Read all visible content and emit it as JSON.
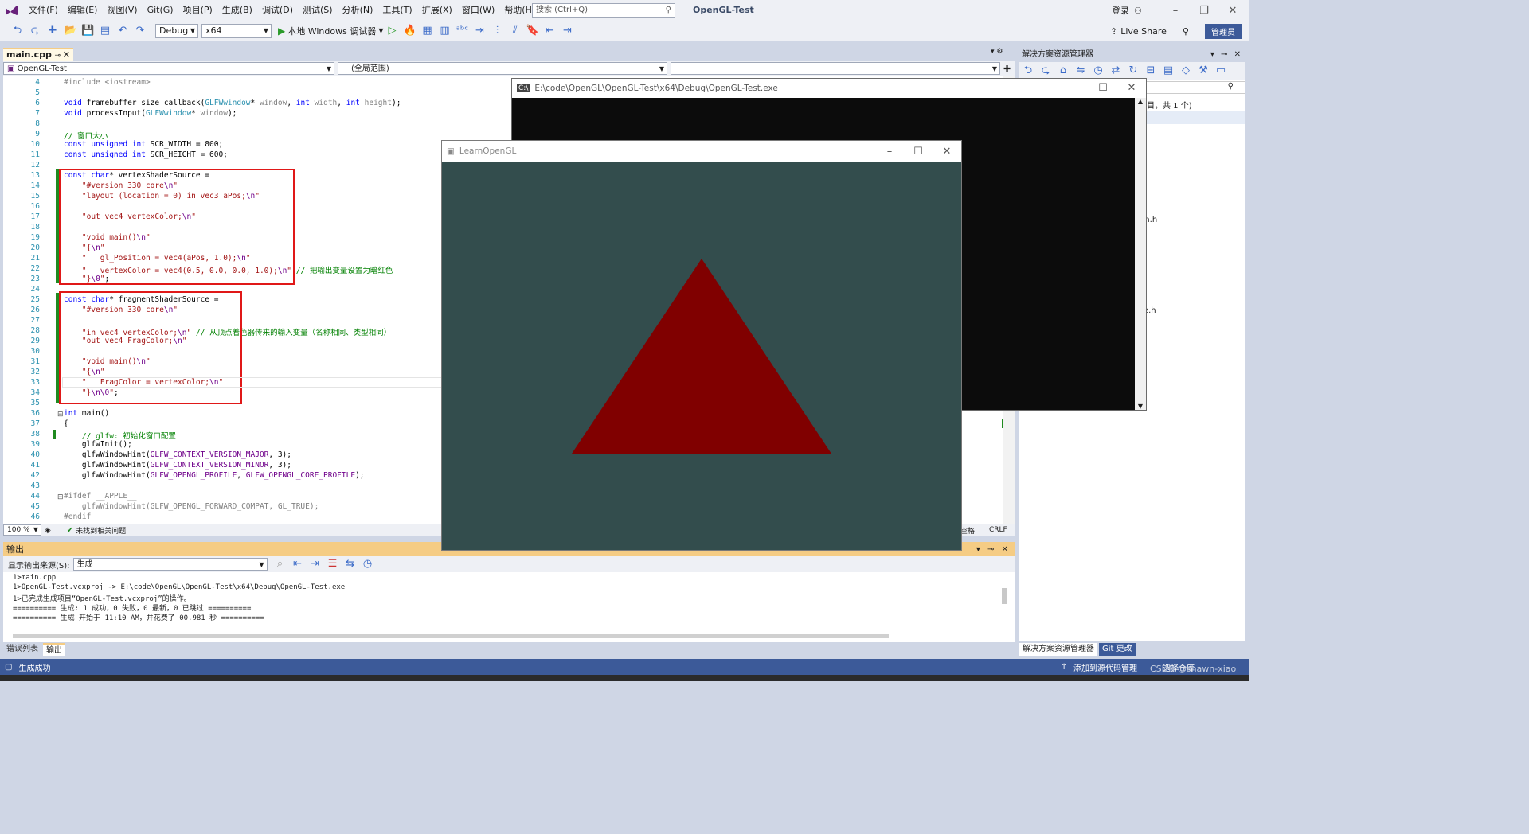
{
  "menubar": {
    "items": [
      "文件(F)",
      "编辑(E)",
      "视图(V)",
      "Git(G)",
      "项目(P)",
      "生成(B)",
      "调试(D)",
      "测试(S)",
      "分析(N)",
      "工具(T)",
      "扩展(X)",
      "窗口(W)",
      "帮助(H)"
    ],
    "search_placeholder": "搜索 (Ctrl+Q)",
    "app_title": "OpenGL-Test",
    "login_label": "登录"
  },
  "toolbar": {
    "config": "Debug",
    "platform": "x64",
    "run_label": "本地 Windows 调试器",
    "live_share_label": "Live Share",
    "admin_label": "管理员"
  },
  "editor": {
    "file_tab": "main.cpp",
    "nav_project": "OpenGL-Test",
    "nav_scope": "(全局范围)",
    "zoom": "100 %",
    "issues": "未找到相关问题",
    "spaces": "空格",
    "line_ending": "CRLF"
  },
  "code_lines": [
    {
      "n": "4",
      "html": "<span class=\"gray\">#include &lt;iostream&gt;</span>"
    },
    {
      "n": "5",
      "html": ""
    },
    {
      "n": "6",
      "html": "<span class=\"kw\">void</span> framebuffer_size_callback(<span class=\"ty\">GLFWwindow</span>* <span class=\"gray\">window</span>, <span class=\"kw\">int</span> <span class=\"gray\">width</span>, <span class=\"kw\">int</span> <span class=\"gray\">height</span>);"
    },
    {
      "n": "7",
      "html": "<span class=\"kw\">void</span> processInput(<span class=\"ty\">GLFWwindow</span>* <span class=\"gray\">window</span>);"
    },
    {
      "n": "8",
      "html": ""
    },
    {
      "n": "9",
      "html": "<span class=\"cm\">// 窗口大小</span>"
    },
    {
      "n": "10",
      "html": "<span class=\"kw\">const unsigned int</span> SCR_WIDTH = 800;"
    },
    {
      "n": "11",
      "html": "<span class=\"kw\">const unsigned int</span> SCR_HEIGHT = 600;"
    },
    {
      "n": "12",
      "html": ""
    },
    {
      "n": "13",
      "html": "<span class=\"kw\">const char</span>* vertexShaderSource ="
    },
    {
      "n": "14",
      "html": "    <span class=\"str\">\"#version 330 core</span><span class=\"mac\">\\n</span><span class=\"str\">\"</span>"
    },
    {
      "n": "15",
      "html": "    <span class=\"str\">\"layout (location = 0) in vec3 aPos;</span><span class=\"mac\">\\n</span><span class=\"str\">\"</span>"
    },
    {
      "n": "16",
      "html": ""
    },
    {
      "n": "17",
      "html": "    <span class=\"str\">\"out vec4 vertexColor;</span><span class=\"mac\">\\n</span><span class=\"str\">\"</span>"
    },
    {
      "n": "18",
      "html": ""
    },
    {
      "n": "19",
      "html": "    <span class=\"str\">\"void main()</span><span class=\"mac\">\\n</span><span class=\"str\">\"</span>"
    },
    {
      "n": "20",
      "html": "    <span class=\"str\">\"{</span><span class=\"mac\">\\n</span><span class=\"str\">\"</span>"
    },
    {
      "n": "21",
      "html": "    <span class=\"str\">\"   gl_Position = vec4(aPos, 1.0);</span><span class=\"mac\">\\n</span><span class=\"str\">\"</span>"
    },
    {
      "n": "22",
      "html": "    <span class=\"str\">\"   vertexColor = vec4(0.5, 0.0, 0.0, 1.0);</span><span class=\"mac\">\\n</span><span class=\"str\">\"</span> <span class=\"cm\">// 把输出变量设置为暗红色</span>"
    },
    {
      "n": "23",
      "html": "    <span class=\"str\">\"}</span><span class=\"mac\">\\0</span><span class=\"str\">\"</span>;"
    },
    {
      "n": "24",
      "html": ""
    },
    {
      "n": "25",
      "html": "<span class=\"kw\">const char</span>* fragmentShaderSource ="
    },
    {
      "n": "26",
      "html": "    <span class=\"str\">\"#version 330 core</span><span class=\"mac\">\\n</span><span class=\"str\">\"</span>"
    },
    {
      "n": "27",
      "html": ""
    },
    {
      "n": "28",
      "html": "    <span class=\"str\">\"in vec4 vertexColor;</span><span class=\"mac\">\\n</span><span class=\"str\">\"</span> <span class=\"cm\">// 从顶点着色器传来的输入变量（名称相同、类型相同）</span>"
    },
    {
      "n": "29",
      "html": "    <span class=\"str\">\"out vec4 FragColor;</span><span class=\"mac\">\\n</span><span class=\"str\">\"</span>"
    },
    {
      "n": "30",
      "html": ""
    },
    {
      "n": "31",
      "html": "    <span class=\"str\">\"void main()</span><span class=\"mac\">\\n</span><span class=\"str\">\"</span>"
    },
    {
      "n": "32",
      "html": "    <span class=\"str\">\"{</span><span class=\"mac\">\\n</span><span class=\"str\">\"</span>"
    },
    {
      "n": "33",
      "html": "    <span class=\"str\">\"   FragColor = vertexColor;</span><span class=\"mac\">\\n</span><span class=\"str\">\"</span>"
    },
    {
      "n": "34",
      "html": "    <span class=\"str\">\"}</span><span class=\"mac\">\\n\\0</span><span class=\"str\">\"</span>;"
    },
    {
      "n": "35",
      "html": ""
    },
    {
      "n": "36",
      "html": "<span class=\"kw\">int</span> main()"
    },
    {
      "n": "37",
      "html": "{"
    },
    {
      "n": "38",
      "html": "    <span class=\"cm\">// glfw: 初始化窗口配置</span>"
    },
    {
      "n": "39",
      "html": "    glfwInit();"
    },
    {
      "n": "40",
      "html": "    glfwWindowHint(<span class=\"mac\">GLFW_CONTEXT_VERSION_MAJOR</span>, 3);"
    },
    {
      "n": "41",
      "html": "    glfwWindowHint(<span class=\"mac\">GLFW_CONTEXT_VERSION_MINOR</span>, 3);"
    },
    {
      "n": "42",
      "html": "    glfwWindowHint(<span class=\"mac\">GLFW_OPENGL_PROFILE</span>, <span class=\"mac\">GLFW_OPENGL_CORE_PROFILE</span>);"
    },
    {
      "n": "43",
      "html": ""
    },
    {
      "n": "44",
      "html": "<span class=\"gray\">#ifdef __APPLE__</span>"
    },
    {
      "n": "45",
      "html": "    <span class=\"gray\">glfwWindowHint(GLFW_OPENGL_FORWARD_COMPAT, GL_TRUE);</span>"
    },
    {
      "n": "46",
      "html": "<span class=\"gray\">#endif</span>"
    }
  ],
  "output": {
    "title": "输出",
    "source_label": "显示输出来源(S):",
    "source_value": "生成",
    "lines": [
      "1>main.cpp",
      "1>OpenGL-Test.vcxproj -> E:\\code\\OpenGL\\OpenGL-Test\\x64\\Debug\\OpenGL-Test.exe",
      "1>已完成生成项目“OpenGL-Test.vcxproj”的操作。",
      "========== 生成: 1 成功，0 失败，0 最新，0 已跳过 ==========",
      "========== 生成 开始于 11:10 AM，并花费了 00.981 秒 =========="
    ]
  },
  "bottom_tabs": [
    "错误列表",
    "输出"
  ],
  "solution_explorer": {
    "title": "解决方案资源管理器",
    "summary": "项目，共 1 个)",
    "file1": "rm.h",
    "file2": "ve.h",
    "tabs": [
      "解决方案资源管理器",
      "Git 更改"
    ]
  },
  "statusbar": {
    "left": "生成成功",
    "right": "添加到源代码管理",
    "repo": "选择仓库",
    "watermark": "CSDN @shawn-xiao"
  },
  "console": {
    "title": "E:\\code\\OpenGL\\OpenGL-Test\\x64\\Debug\\OpenGL-Test.exe"
  },
  "glwindow": {
    "title": "LearnOpenGL",
    "background": "#334d4d",
    "triangle_color": "#800000"
  }
}
